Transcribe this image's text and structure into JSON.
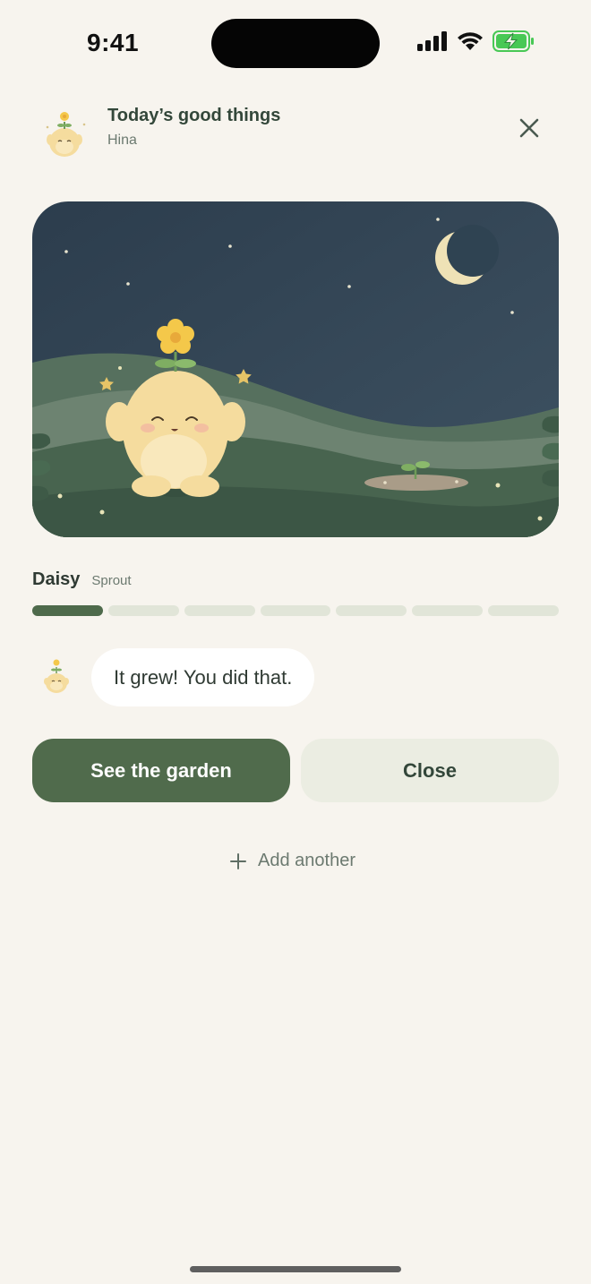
{
  "status_bar": {
    "time": "9:41"
  },
  "header": {
    "title": "Today’s good things",
    "subtitle": "Hina"
  },
  "plant": {
    "name": "Daisy",
    "stage": "Sprout",
    "progress_filled_segments": 1,
    "progress_total_segments": 7
  },
  "message": {
    "text": "It grew! You did that."
  },
  "buttons": {
    "primary": "See the garden",
    "secondary": "Close"
  },
  "add_another": {
    "label": "Add another"
  },
  "colors": {
    "accent": "#506B4C",
    "background": "#F7F4EE",
    "secondary_button": "#EBEDE2",
    "progress_empty": "#E1E5D8",
    "night_sky": "#34495A"
  }
}
